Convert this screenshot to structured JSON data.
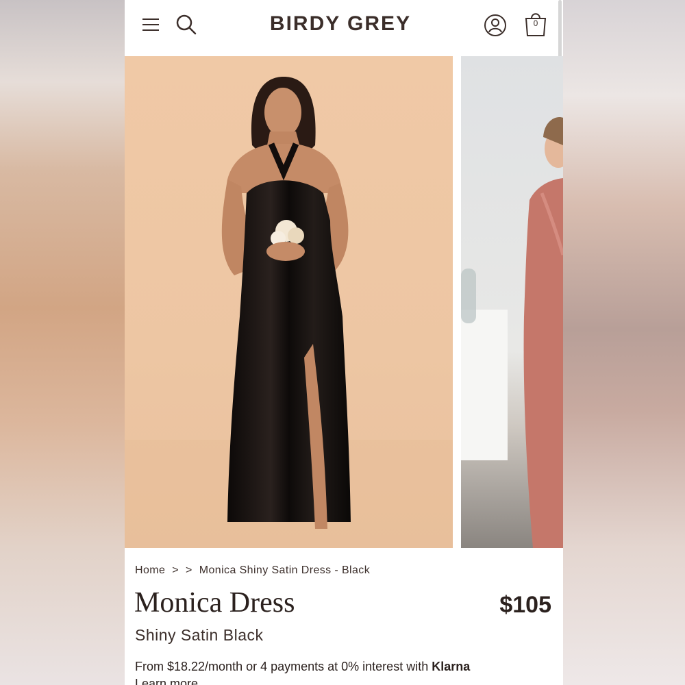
{
  "header": {
    "logo": "BIRDY GREY",
    "cart_count": "0",
    "icons": [
      "menu-icon",
      "search-icon",
      "account-icon",
      "cart-icon"
    ]
  },
  "gallery": {
    "images": [
      {
        "subject": "black-satin-halter-dress-model",
        "color": "#120d0c",
        "background": "#eec7a4"
      },
      {
        "subject": "rose-satin-halter-dress-model",
        "color": "#c5776a",
        "background": "#e2e3e4"
      }
    ]
  },
  "breadcrumb": {
    "home": "Home",
    "separator_1": ">",
    "separator_2": ">",
    "current": "Monica Shiny Satin Dress - Black"
  },
  "product": {
    "title": "Monica Dress",
    "price": "$105",
    "subtitle": "Shiny Satin Black",
    "financing_text": "From $18.22/month or 4 payments at 0% interest with",
    "financing_brand": "Klarna",
    "learn_more": "Learn more"
  },
  "colors": {
    "text": "#2b211e",
    "logo": "#3b2e2a"
  }
}
